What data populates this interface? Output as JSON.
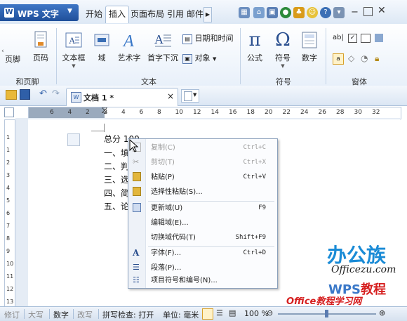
{
  "app": {
    "name": "WPS 文字"
  },
  "tabs": [
    {
      "label": "开始"
    },
    {
      "label": "插入",
      "active": true
    },
    {
      "label": "页面布局"
    },
    {
      "label": "引用"
    },
    {
      "label": "邮件"
    }
  ],
  "ribbon": {
    "header_footer": {
      "footer_label": "页脚",
      "page_number_label": "页码",
      "group_label": "和页脚"
    },
    "text": {
      "textbox_label": "文本框",
      "field_label": "域",
      "wordart_label": "艺术字",
      "dropcap_label": "首字下沉",
      "datetime_label": "日期和时间",
      "object_label": "对象",
      "group_label": "文本"
    },
    "symbols": {
      "formula_label": "公式",
      "symbol_label": "符号",
      "number_label": "数字",
      "group_label": "符号"
    },
    "forms": {
      "group_label": "窗体"
    }
  },
  "toolbar": {
    "doc_tab_label": "文档 1 *",
    "close_label": "×"
  },
  "ruler": {
    "h_labels": [
      "6",
      "4",
      "2",
      "2",
      "4",
      "6",
      "8",
      "10",
      "12",
      "14",
      "16",
      "18",
      "20",
      "22",
      "24",
      "26",
      "28",
      "30",
      "32"
    ],
    "v_labels": [
      "1",
      "1",
      "2",
      "3",
      "4",
      "5",
      "6",
      "7",
      "8",
      "9",
      "10",
      "11",
      "12",
      "13"
    ]
  },
  "document": {
    "lines": [
      "总分 100",
      "一、填",
      "二、判",
      "三、选",
      "四、简",
      "五、论"
    ]
  },
  "context_menu": {
    "items": [
      {
        "label": "复制(C)",
        "shortcut": "Ctrl+C",
        "disabled": true,
        "icon": "copy-icon"
      },
      {
        "label": "剪切(T)",
        "shortcut": "Ctrl+X",
        "disabled": true,
        "icon": "cut-icon"
      },
      {
        "label": "粘贴(P)",
        "shortcut": "Ctrl+V",
        "disabled": false,
        "icon": "paste-icon"
      },
      {
        "label": "选择性粘贴(S)...",
        "shortcut": "",
        "disabled": false,
        "icon": "paste-special-icon"
      },
      {
        "label": "更新域(U)",
        "shortcut": "F9",
        "disabled": false,
        "icon": "update-field-icon"
      },
      {
        "label": "编辑域(E)...",
        "shortcut": "",
        "disabled": false,
        "icon": ""
      },
      {
        "label": "切换域代码(T)",
        "shortcut": "Shift+F9",
        "disabled": false,
        "icon": ""
      },
      {
        "label": "字体(F)...",
        "shortcut": "Ctrl+D",
        "disabled": false,
        "icon": "font-icon"
      },
      {
        "label": "段落(P)...",
        "shortcut": "",
        "disabled": false,
        "icon": "paragraph-icon"
      },
      {
        "label": "项目符号和编号(N)...",
        "shortcut": "",
        "disabled": false,
        "icon": "bullets-icon"
      }
    ]
  },
  "status": {
    "revise": "修订",
    "caps": "大写",
    "num": "数字",
    "overwrite": "改写",
    "spell": "拼写检查: 打开",
    "unit": "单位: 毫米",
    "zoom": "100 %"
  },
  "watermark": {
    "brand_cn": "办公族",
    "brand_en": "Officezu.com",
    "wps_en": "WPS",
    "wps_cn": "教程",
    "site": "Office教程学习网 www.office68.com"
  },
  "colors": {
    "accent": "#1f4f9a",
    "ribbon_border": "#a9bfd9"
  }
}
